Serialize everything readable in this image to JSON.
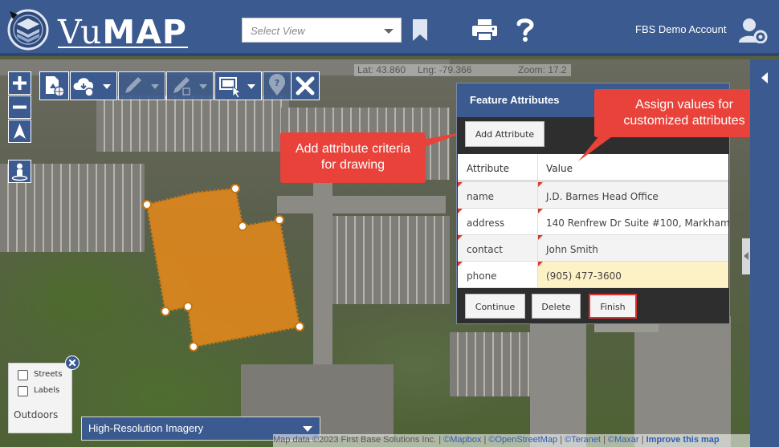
{
  "header": {
    "logo_text_light": "Vu",
    "logo_text_bold": "MAP",
    "view_select_placeholder": "Select View",
    "account_name": "FBS Demo Account"
  },
  "coords": {
    "lat": "Lat: 43.860",
    "lng": "Lng: -79.366",
    "zoom": "Zoom: 17.2"
  },
  "callouts": {
    "add_attribute": "Add attribute criteria for drawing",
    "assign_values": "Assign values for customized attributes"
  },
  "panel": {
    "title": "Feature Attributes",
    "add_attribute_label": "Add Attribute",
    "col_attribute": "Attribute",
    "col_value": "Value",
    "rows": [
      {
        "attribute": "name",
        "value": "J.D. Barnes Head Office"
      },
      {
        "attribute": "address",
        "value": "140 Renfrew Dr Suite #100, Markham"
      },
      {
        "attribute": "contact",
        "value": "John Smith"
      },
      {
        "attribute": "phone",
        "value": "(905) 477-3600"
      }
    ],
    "continue_label": "Continue",
    "delete_label": "Delete",
    "finish_label": "Finish"
  },
  "layers": {
    "streets_label": "Streets",
    "labels_label": "Labels",
    "outdoors_label": "Outdoors",
    "basemap_selected": "High-Resolution Imagery"
  },
  "attribution": {
    "prefix": "Map data ©2023 First Base Solutions Inc. | ",
    "mapbox": "©Mapbox",
    "osm": "©OpenStreetMap",
    "teranet": "©Teranet",
    "maxar": "©Maxar",
    "improve": "Improve this map"
  },
  "colors": {
    "header_blue": "#3b5a8f",
    "polygon_fill": "#e88a1a",
    "callout_red": "#e9423a",
    "highlight_row": "#fdf1c6",
    "finish_border": "#e03030"
  },
  "icons": {
    "logo": "globe-layers-icon",
    "bookmark": "bookmark-icon",
    "print": "printer-icon",
    "help": "question-icon",
    "account": "user-gear-icon",
    "zoom_in": "plus-icon",
    "zoom_out": "minus-icon",
    "north": "north-arrow-icon",
    "street_view": "person-icon",
    "add_file": "add-file-globe-icon",
    "download": "cloud-download-icon",
    "draw": "pencil-icon",
    "edit": "pencil-edit-icon",
    "select": "select-pointer-icon",
    "locate": "location-question-icon",
    "close": "close-icon",
    "collapse": "chevron-left-icon"
  }
}
